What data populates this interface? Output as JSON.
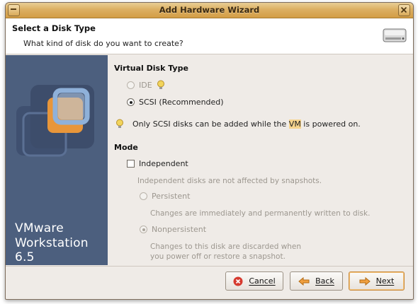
{
  "window": {
    "title": "Add Hardware Wizard"
  },
  "header": {
    "title": "Select a Disk Type",
    "subtitle": "What kind of disk do you want to create?",
    "icon": "hard-disk-icon"
  },
  "sidebar": {
    "brand_line1": "VMware",
    "brand_line2": "Workstation 6.5"
  },
  "virtual_disk_type": {
    "heading": "Virtual Disk Type",
    "options": [
      {
        "label": "IDE",
        "selected": false,
        "enabled": false
      },
      {
        "label": "SCSI (Recommended)",
        "selected": true,
        "enabled": true
      }
    ],
    "hint_pre": "Only SCSI disks can be added while the ",
    "hint_highlight": "VM",
    "hint_post": " is powered on."
  },
  "mode": {
    "heading": "Mode",
    "independent": {
      "label": "Independent",
      "checked": false
    },
    "independent_desc": "Independent disks are not affected by snapshots.",
    "persistent": {
      "label": "Persistent",
      "selected": false,
      "enabled": false
    },
    "persistent_desc": "Changes are immediately and permanently written to disk.",
    "nonpersistent": {
      "label": "Nonpersistent",
      "selected": true,
      "enabled": false
    },
    "nonpersistent_desc_line1": "Changes to this disk are discarded when",
    "nonpersistent_desc_line2": "you power off or restore a snapshot."
  },
  "buttons": {
    "cancel": "Cancel",
    "back": "Back",
    "next": "Next"
  },
  "colors": {
    "titlebar": "#d9a85a",
    "sidebar": "#4c5f7e",
    "accent": "#e8963a"
  }
}
